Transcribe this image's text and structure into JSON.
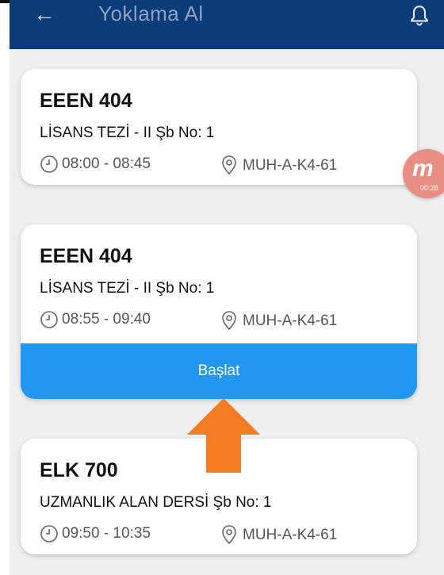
{
  "appbar": {
    "title": "Yoklama Al",
    "back_icon": "arrow-left-icon",
    "bell_icon": "bell-icon"
  },
  "cards": [
    {
      "course": "EEEN 404",
      "desc": "LİSANS TEZİ - II Şb No: 1",
      "time": "08:00 - 08:45",
      "location": "MUH-A-K4-61"
    },
    {
      "course": "EEEN 404",
      "desc": "LİSANS TEZİ - II Şb No: 1",
      "time": "08:55 - 09:40",
      "location": "MUH-A-K4-61",
      "button": "Başlat"
    },
    {
      "course": "ELK 700",
      "desc": "UZMANLIK ALAN DERSİ Şb No: 1",
      "time": "09:50 - 10:35",
      "location": "MUH-A-K4-61"
    }
  ],
  "badge": {
    "letter": "m",
    "time": "00:28"
  },
  "colors": {
    "appbar": "#0b3c7a",
    "button": "#2196f3",
    "arrow": "#f57c22",
    "badge": "#e98e83"
  }
}
